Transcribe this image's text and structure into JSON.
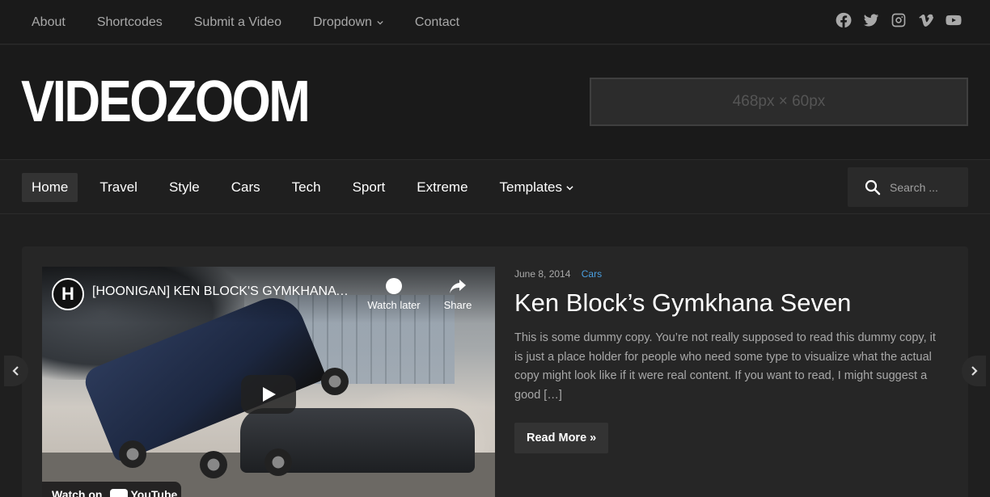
{
  "topnav": {
    "items": [
      {
        "label": "About"
      },
      {
        "label": "Shortcodes"
      },
      {
        "label": "Submit a Video"
      },
      {
        "label": "Dropdown"
      },
      {
        "label": "Contact"
      }
    ],
    "social_icons": [
      "facebook-icon",
      "twitter-icon",
      "instagram-icon",
      "vimeo-icon",
      "youtube-icon"
    ]
  },
  "header": {
    "logo": "VIDEOZOOM",
    "ad_placeholder": "468px × 60px"
  },
  "mainnav": {
    "items": [
      {
        "label": "Home",
        "active": true
      },
      {
        "label": "Travel"
      },
      {
        "label": "Style"
      },
      {
        "label": "Cars"
      },
      {
        "label": "Tech"
      },
      {
        "label": "Sport"
      },
      {
        "label": "Extreme"
      },
      {
        "label": "Templates"
      }
    ],
    "search_placeholder": "Search ..."
  },
  "slide": {
    "video": {
      "channel_letter": "H",
      "title": "[HOONIGAN] KEN BLOCK'S GYMKHANA SEVEN",
      "watch_later": "Watch later",
      "share": "Share",
      "watch_on": "Watch on",
      "youtube": "YouTube"
    },
    "date": "June 8, 2014",
    "category": "Cars",
    "title": "Ken Block’s Gymkhana Seven",
    "excerpt": "This is some dummy copy. You’re not really supposed to read this dummy copy, it is just a place holder for people who need some type to visualize what the actual copy might look like if it were real content. If you want to read, I might suggest a good […]",
    "read_more": "Read More »"
  },
  "colors": {
    "background": "#1f1f1f",
    "accent": "#4a9fe0",
    "muted_text": "#a8a8a8"
  }
}
